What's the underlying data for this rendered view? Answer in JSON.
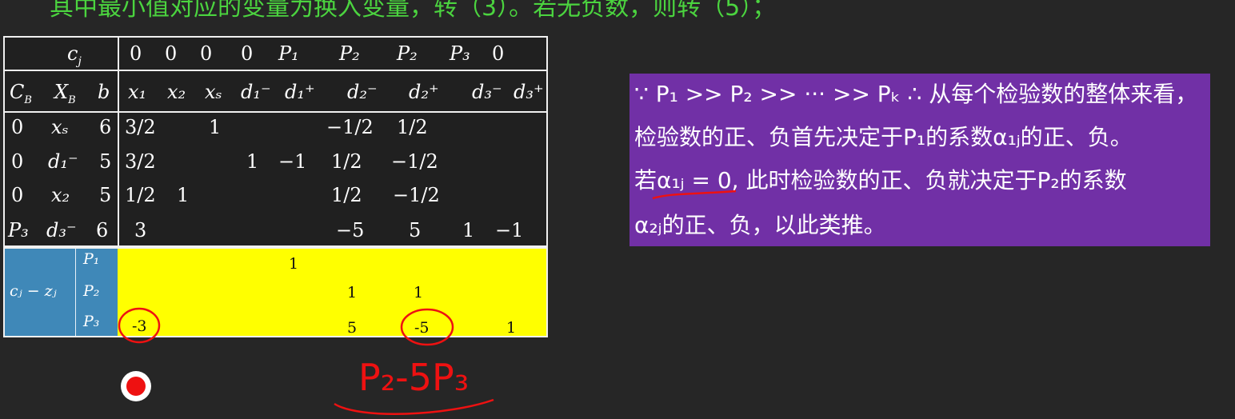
{
  "top_line": "其中最小值对应的变量为换入变量，转（3）。若无负数，则转（5）；",
  "table": {
    "cj_label": "c",
    "cj_sub": "j",
    "cj_values": [
      "0",
      "0",
      "0",
      "0",
      "P₁",
      "P₂",
      "P₂",
      "P₃",
      "0"
    ],
    "headers": [
      "C",
      "X",
      "b",
      "x₁",
      "x₂",
      "xₛ",
      "d₁⁻",
      "d₁⁺",
      "d₂⁻",
      "d₂⁺",
      "d₃⁻",
      "d₃⁺"
    ],
    "header_subs": [
      "B",
      "B"
    ],
    "rows": [
      {
        "cb": "0",
        "xb": "xₛ",
        "b": "6",
        "vals": [
          "3/2",
          "",
          "1",
          "",
          "",
          "−1/2",
          "1/2",
          "",
          ""
        ]
      },
      {
        "cb": "0",
        "xb": "d₁⁻",
        "b": "5",
        "vals": [
          "3/2",
          "",
          "",
          "1",
          "−1",
          "1/2",
          "−1/2",
          "",
          ""
        ]
      },
      {
        "cb": "0",
        "xb": "x₂",
        "b": "5",
        "vals": [
          "1/2",
          "1",
          "",
          "",
          "",
          "1/2",
          "−1/2",
          "",
          ""
        ]
      },
      {
        "cb": "P₃",
        "xb": "d₃⁻",
        "b": "6",
        "vals": [
          "3",
          "",
          "",
          "",
          "",
          "−5",
          "5",
          "1",
          "−1"
        ]
      }
    ]
  },
  "bottom": {
    "label": "cⱼ − zⱼ",
    "priorities": [
      "P₁",
      "P₂",
      "P₃"
    ],
    "p1_vals": [
      "1"
    ],
    "p2_vals": [
      "1",
      "1"
    ],
    "p3_vals": [
      "-3",
      "5",
      "-5",
      "1"
    ]
  },
  "annotation": {
    "handwriting": "P₂-5P₃"
  },
  "explanation": {
    "line1": "∵ P₁ >> P₂ >> ··· >> Pₖ ∴ 从每个检验数的整体来看，",
    "line2": "检验数的正、负首先决定于P₁的系数α₁ⱼ的正、负。",
    "line3": "若α₁ⱼ = 0, 此时检验数的正、负就决定于P₂的系数",
    "line4": "α₂ⱼ的正、负，以此类推。"
  },
  "colors": {
    "background": "#262626",
    "top_text": "#4bd43f",
    "highlight_yellow": "#ffff00",
    "blue_label": "#3f88b8",
    "purple_box": "#7130a6",
    "annotation_red": "#ee1111"
  }
}
